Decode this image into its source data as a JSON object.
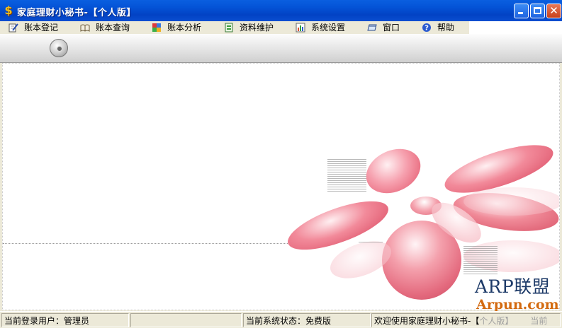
{
  "window": {
    "title": "家庭理财小秘书-【个人版】",
    "app_icon_glyph": "$"
  },
  "menu": [
    {
      "label": "账本登记",
      "icon": "notepad-pen-icon"
    },
    {
      "label": "账本查询",
      "icon": "open-book-icon"
    },
    {
      "label": "账本分析",
      "icon": "colorful-cubes-icon"
    },
    {
      "label": "资料维护",
      "icon": "green-document-icon"
    },
    {
      "label": "系统设置",
      "icon": "settings-chart-icon"
    },
    {
      "label": "窗口",
      "icon": "window-icon"
    },
    {
      "label": "帮助",
      "icon": "help-circle-icon"
    }
  ],
  "toolbar": {
    "disc_icon": "cd-disc-icon"
  },
  "status": {
    "user": "当前登录用户：管理员",
    "blank": "",
    "system_state": "当前系统状态：免费版",
    "welcome_prefix": "欢迎使用家庭理财小秘书-【",
    "welcome_suffix": "个人版】",
    "current_cut": "当前"
  },
  "watermark": {
    "line1": "ARP联盟",
    "line2": "Arpun.com"
  },
  "colors": {
    "titlebar_blue": "#0453d6",
    "bubble_pink": "#f07a8a",
    "watermark_navy": "#1d3a68",
    "watermark_orange": "#d36a10"
  }
}
